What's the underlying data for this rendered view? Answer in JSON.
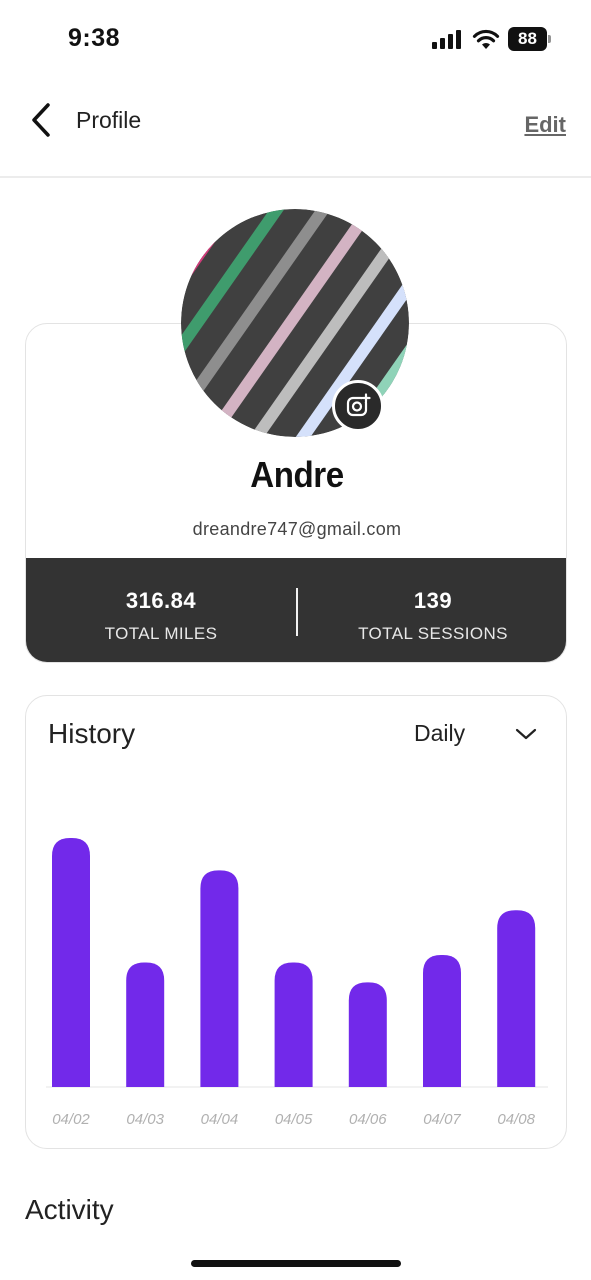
{
  "status_bar": {
    "time": "9:38",
    "battery": "88",
    "icons": [
      "cellular-signal-icon",
      "wifi-icon",
      "battery-icon"
    ]
  },
  "header": {
    "title": "Profile",
    "edit_label": "Edit",
    "back_icon": "chevron-left-icon"
  },
  "profile": {
    "name": "Andre",
    "email": "dreandre747@gmail.com",
    "avatar_icon": "striped-avatar-image",
    "camera_icon": "add-photo-icon",
    "stats": [
      {
        "value": "316.84",
        "label": "TOTAL MILES"
      },
      {
        "value": "139",
        "label": "TOTAL SESSIONS"
      }
    ]
  },
  "history": {
    "title": "History",
    "range": "Daily",
    "range_icon": "chevron-down-icon"
  },
  "chart_data": {
    "type": "bar",
    "title": "",
    "xlabel": "",
    "ylabel": "",
    "categories": [
      "04/02",
      "04/03",
      "04/04",
      "04/05",
      "04/06",
      "04/07",
      "04/08"
    ],
    "values": [
      100,
      50,
      87,
      50,
      42,
      53,
      71
    ],
    "ylim": [
      0,
      100
    ],
    "bar_color": "#7229ea",
    "grid": false
  },
  "activity": {
    "heading": "Activity"
  },
  "colors": {
    "accent": "#7229ea",
    "stats_bar": "#333333"
  }
}
